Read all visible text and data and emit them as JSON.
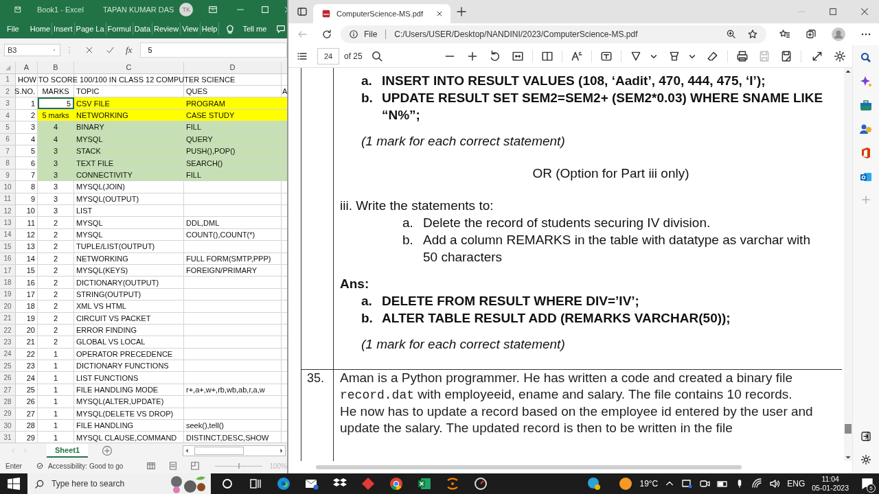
{
  "excel": {
    "title": "Book1  -  Excel",
    "user": "TAPAN KUMAR DAS",
    "avatar": "TK",
    "ribbon_tabs": [
      "File",
      "Home",
      "Insert",
      "Page La",
      "Formul",
      "Data",
      "Review",
      "View",
      "Help"
    ],
    "tell_me": "Tell me",
    "name_box": "B3",
    "function_button": "fx",
    "formula": "5",
    "column_headers": [
      "A",
      "B",
      "C",
      "D"
    ],
    "rows": [
      {
        "number": "1",
        "title": "HOW TO SCORE 100/100 IN CLASS 12 COMPUTER SCIENCE"
      },
      {
        "number": "2",
        "sno": "S.NO.",
        "marks": "MARKS",
        "topic": "TOPIC",
        "ques": "QUES",
        "column_5": "A"
      },
      {
        "number": "3",
        "sno": "1",
        "marks": "5",
        "topic": "CSV FILE",
        "ques": "PROGRAM",
        "color": "#ffff00",
        "selected": true
      },
      {
        "number": "4",
        "sno": "2",
        "marks": "5 marks",
        "topic": "NETWORKING",
        "ques": "CASE STUDY",
        "color": "#ffff00",
        "selected": false
      },
      {
        "number": "5",
        "sno": "3",
        "marks": "4",
        "topic": "BINARY",
        "ques": "FILL",
        "color": "#c6e0b4",
        "selected": false
      },
      {
        "number": "6",
        "sno": "4",
        "marks": "4",
        "topic": "MYSQL",
        "ques": "QUERY",
        "color": "#c6e0b4",
        "selected": false
      },
      {
        "number": "7",
        "sno": "5",
        "marks": "3",
        "topic": "STACK",
        "ques": "PUSH(),POP()",
        "color": "#c6e0b4",
        "selected": false
      },
      {
        "number": "8",
        "sno": "6",
        "marks": "3",
        "topic": "TEXT FILE",
        "ques": "SEARCH()",
        "color": "#c6e0b4",
        "selected": false
      },
      {
        "number": "9",
        "sno": "7",
        "marks": "3",
        "topic": "CONNECTIVITY",
        "ques": "FILL",
        "color": "#c6e0b4",
        "selected": false
      },
      {
        "number": "10",
        "sno": "8",
        "marks": "3",
        "topic": "MYSQL(JOIN)",
        "selected": false
      },
      {
        "number": "11",
        "sno": "9",
        "marks": "3",
        "topic": "MYSQL(OUTPUT)",
        "selected": false
      },
      {
        "number": "12",
        "sno": "10",
        "marks": "3",
        "topic": "LIST",
        "selected": false
      },
      {
        "number": "13",
        "sno": "11",
        "marks": "2",
        "topic": "MYSQL",
        "ques": "DDL,DML",
        "selected": false
      },
      {
        "number": "14",
        "sno": "12",
        "marks": "2",
        "topic": "MYSQL",
        "ques": "COUNT(),COUNT(*)",
        "selected": false
      },
      {
        "number": "15",
        "sno": "13",
        "marks": "2",
        "topic": "TUPLE/LIST(OUTPUT)",
        "selected": false
      },
      {
        "number": "16",
        "sno": "14",
        "marks": "2",
        "topic": "NETWORKING",
        "ques": "FULL FORM(SMTP,PPP)",
        "selected": false
      },
      {
        "number": "17",
        "sno": "15",
        "marks": "2",
        "topic": "MYSQL(KEYS)",
        "ques": "FOREIGN/PRIMARY",
        "selected": false
      },
      {
        "number": "18",
        "sno": "16",
        "marks": "2",
        "topic": "DICTIONARY(OUTPUT)",
        "selected": false
      },
      {
        "number": "19",
        "sno": "17",
        "marks": "2",
        "topic": "STRING(OUTPUT)",
        "selected": false
      },
      {
        "number": "20",
        "sno": "18",
        "marks": "2",
        "topic": "XML VS HTML",
        "selected": false
      },
      {
        "number": "21",
        "sno": "19",
        "marks": "2",
        "topic": "CIRCUIT VS PACKET",
        "selected": false
      },
      {
        "number": "22",
        "sno": "20",
        "marks": "2",
        "topic": "ERROR FINDING",
        "selected": false
      },
      {
        "number": "23",
        "sno": "21",
        "marks": "2",
        "topic": "GLOBAL VS LOCAL",
        "selected": false
      },
      {
        "number": "24",
        "sno": "22",
        "marks": "1",
        "topic": "OPERATOR PRECEDENCE",
        "selected": false
      },
      {
        "number": "25",
        "sno": "23",
        "marks": "1",
        "topic": "DICTIONARY FUNCTIONS",
        "selected": false
      },
      {
        "number": "26",
        "sno": "24",
        "marks": "1",
        "topic": "LIST FUNCTIONS",
        "selected": false
      },
      {
        "number": "27",
        "sno": "25",
        "marks": "1",
        "topic": "FILE HANDLING MODE",
        "ques": "r+,a+,w+,rb,wb,ab,r,a,w",
        "selected": false
      },
      {
        "number": "28",
        "sno": "26",
        "marks": "1",
        "topic": "MYSQL(ALTER,UPDATE)",
        "selected": false
      },
      {
        "number": "29",
        "sno": "27",
        "marks": "1",
        "topic": "MYSQL(DELETE VS DROP)",
        "selected": false
      },
      {
        "number": "30",
        "sno": "28",
        "marks": "1",
        "topic": "FILE HANDLING",
        "ques": "seek(),tell()",
        "selected": false
      },
      {
        "number": "31",
        "sno": "29",
        "marks": "1",
        "topic": "MYSQL CLAUSE,COMMAND",
        "ques": "DISTINCT,DESC,SHOW",
        "selected": false
      }
    ],
    "sheet_tabs": [
      {
        "label": "Sheet1",
        "selected": true
      }
    ],
    "status": "Enter",
    "accessibility": "Accessibility: Good to go",
    "zoom_slider": {
      "level": 0.5
    },
    "zoom": "100%"
  },
  "browser": {
    "tab_title": "ComputerScience-MS.pdf",
    "address_scheme": "File",
    "url": "C:/Users/USER/Desktop/NANDINI/2023/ComputerScience-MS.pdf",
    "page_number": "24",
    "page_count": "of 25",
    "document": {
      "blocks": [
        {
          "kind": "answer",
          "marker": "a.",
          "text": "INSERT INTO RESULT VALUES (108, ‘Aadit’, 470, 444, 475, ‘I’);"
        },
        {
          "kind": "answer",
          "marker": "b.",
          "text": "UPDATE RESULT SET SEM2=SEM2+ (SEM2*0.03) WHERE SNAME LIKE “N%”;"
        },
        {
          "kind": "note",
          "text": "(1 mark for each correct statement)"
        },
        {
          "kind": "or",
          "text": "OR (Option for Part iii only)"
        },
        {
          "kind": "prompt",
          "text": "iii. Write the statements to:"
        },
        {
          "kind": "subitem",
          "marker": "a.",
          "text": "Delete the record of students securing IV division."
        },
        {
          "kind": "subitem",
          "marker": "b.",
          "text": "Add a column REMARKS in the table with datatype as varchar with 50 characters"
        },
        {
          "kind": "label",
          "text": "Ans:"
        },
        {
          "kind": "answer",
          "marker": "a.",
          "text": "DELETE FROM RESULT WHERE DIV=’IV’;"
        },
        {
          "kind": "answer",
          "marker": "b.",
          "text": "ALTER TABLE RESULT ADD (REMARKS VARCHAR(50));"
        },
        {
          "kind": "note",
          "text": "(1 mark for each correct statement)"
        }
      ],
      "question": {
        "number": "35.",
        "paragraphs": [
          {
            "before": "Aman is a Python programmer. He has written a code and created a binary file",
            "code": "record.dat",
            "after": "with employeeid, ename and salary. The file contains 10 records."
          },
          {
            "before": "He now has to update a record based on the employee id entered by the user and update the salary. The updated record is then to be written in the file"
          }
        ]
      }
    }
  },
  "taskbar": {
    "search_placeholder": "Type here to search",
    "temperature": "19°C",
    "language": "ENG",
    "time": "11:04",
    "date": "05-01-2023",
    "notifications": "5"
  }
}
